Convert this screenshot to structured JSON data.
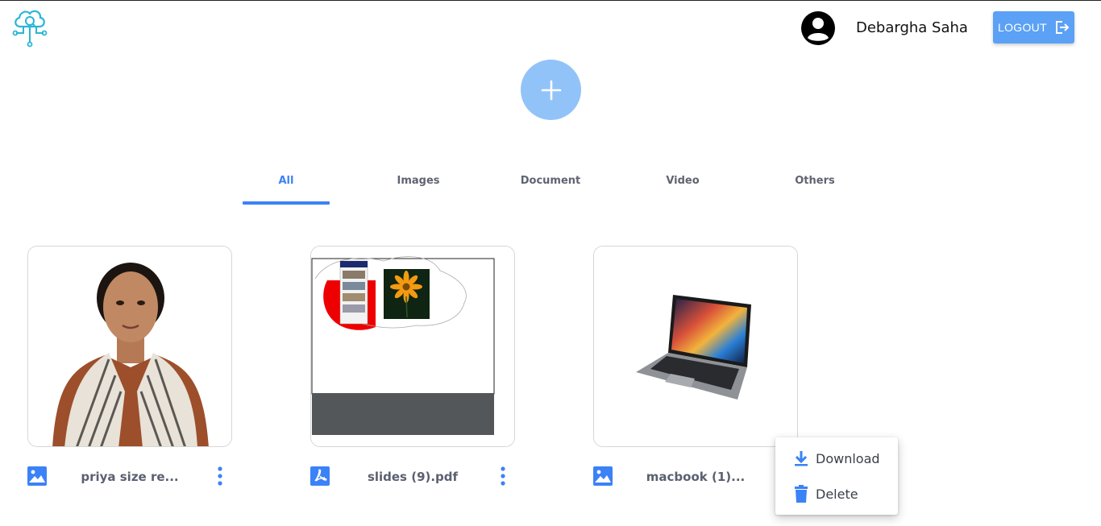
{
  "header": {
    "user_name": "Debargha Saha",
    "logout_label": "LOGOUT"
  },
  "tabs": [
    {
      "label": "All",
      "active": true
    },
    {
      "label": "Images",
      "active": false
    },
    {
      "label": "Document",
      "active": false
    },
    {
      "label": "Video",
      "active": false
    },
    {
      "label": "Others",
      "active": false
    }
  ],
  "files": [
    {
      "name": "priya size re...",
      "type": "image",
      "icon": "image-icon"
    },
    {
      "name": "slides (9).pdf",
      "type": "pdf",
      "icon": "pdf-icon"
    },
    {
      "name": "macbook (1)...",
      "type": "image",
      "icon": "image-icon"
    }
  ],
  "context_menu": {
    "download_label": "Download",
    "delete_label": "Delete"
  },
  "colors": {
    "accent": "#3b82f6",
    "logout_bg": "#5ba1f5",
    "add_button_bg": "#92c3f8",
    "logo": "#29b6d6"
  }
}
